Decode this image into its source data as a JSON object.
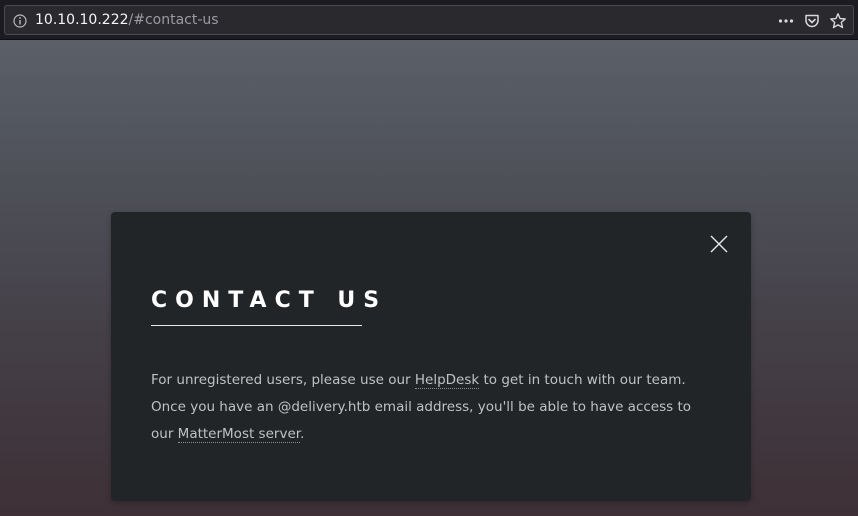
{
  "browser": {
    "url_host": "10.10.10.222",
    "url_path": "/#contact-us",
    "icons": {
      "info": "info-icon",
      "menu": "more-actions-icon",
      "pocket": "pocket-icon",
      "bookmark": "bookmark-star-icon"
    }
  },
  "modal": {
    "title": "CONTACT US",
    "close_icon": "close-icon",
    "body": {
      "part1": "For unregistered users, please use our ",
      "link1": "HelpDesk",
      "part2": " to get in touch with our team. Once you have an @delivery.htb email address, you'll be able to have access to our ",
      "link2": "MatterMost server",
      "part3": "."
    }
  },
  "colors": {
    "modal_bg": "#222528",
    "text": "#bfc1c4",
    "title": "#ffffff"
  }
}
